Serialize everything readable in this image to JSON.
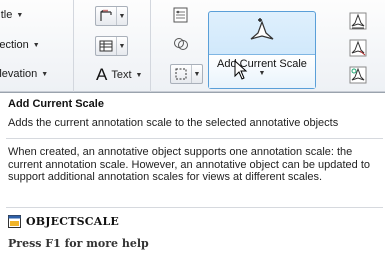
{
  "ribbon": {
    "left_items": [
      {
        "label": "Title",
        "icon": "chevron-down-icon"
      },
      {
        "label": "Section",
        "icon": "chevron-down-icon"
      },
      {
        "label": "Elevation",
        "icon": "chevron-down-icon"
      }
    ],
    "dimension_button": {
      "icon": "dimension-icon"
    },
    "table_button": {
      "icon": "table-icon"
    },
    "text_button": {
      "glyph": "A",
      "label": "Text"
    },
    "scale_list_icon": "scale-list-icon",
    "sync_icon": "sync-scales-icon",
    "selection_button": {
      "icon": "selection-box-icon"
    },
    "add_scale_button": {
      "label": "Add Current Scale",
      "icon": "annotation-scale-icon"
    },
    "right_icons": [
      "add-scale-icon",
      "delete-scale-icon",
      "sync-annotation-icon"
    ]
  },
  "tooltip": {
    "title": "Add Current Scale",
    "description": "Adds the current annotation scale to the selected annotative objects",
    "body": "When created, an annotative object supports one annotation scale: the current annotation scale. However, an annotative object can be updated to support additional annotation scales for views at different scales.",
    "command": "OBJECTSCALE",
    "help": "Press F1 for more help"
  },
  "colors": {
    "highlight": "#c5e2f9",
    "highlight_border": "#5a9fd8"
  }
}
